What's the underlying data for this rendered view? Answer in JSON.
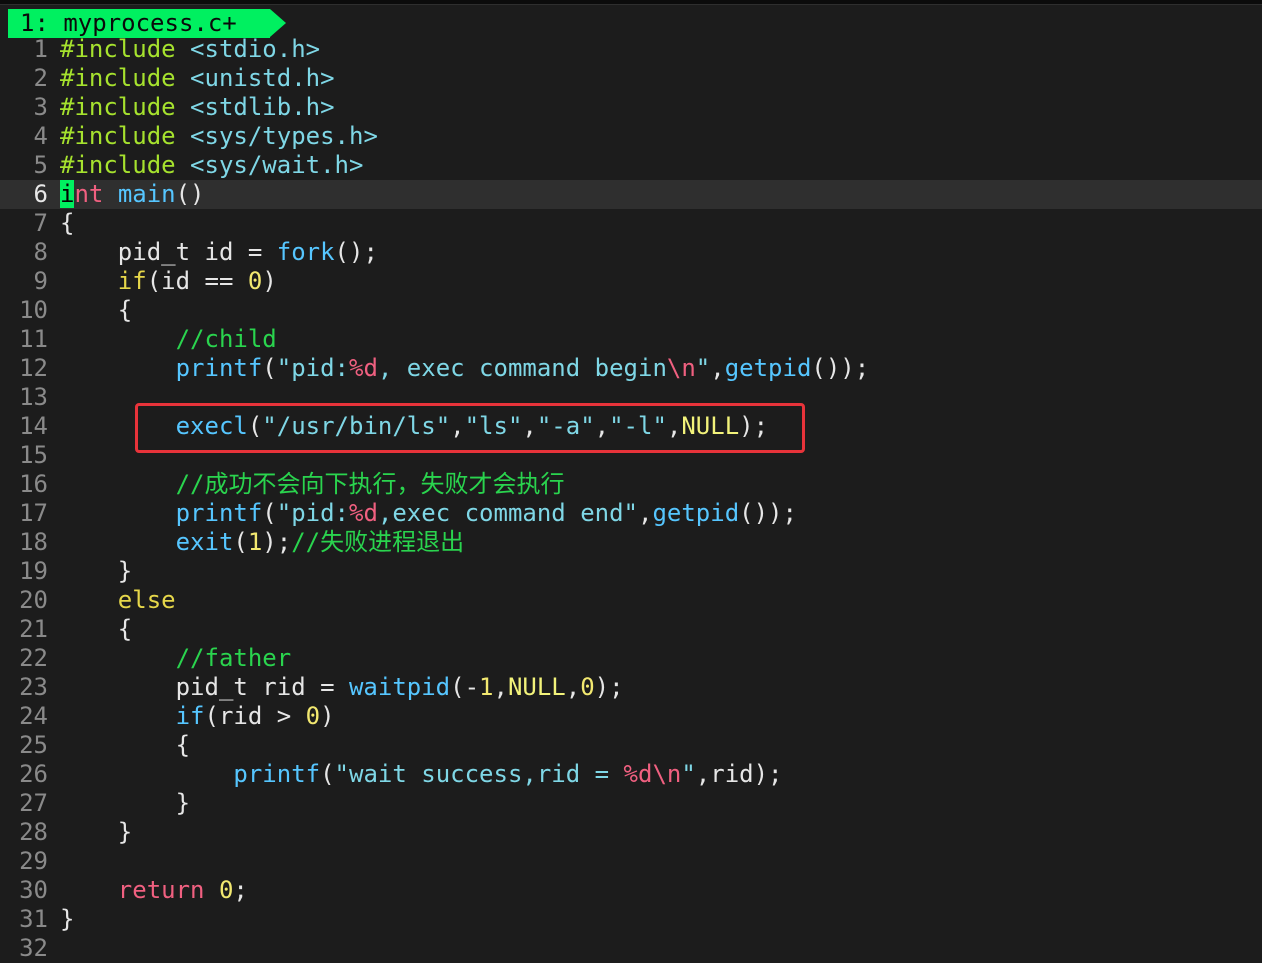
{
  "tab": {
    "label": "1: myprocess.c+"
  },
  "cursor_line": 6,
  "highlight": {
    "line": 14,
    "color": "#e8333a"
  },
  "colors": {
    "tab_bg": "#00f060",
    "background": "#1c1c1c",
    "current_line": "#2f2f2f"
  },
  "lines": [
    {
      "n": "1",
      "segs": [
        [
          "pre",
          "#include"
        ],
        [
          "plain",
          " "
        ],
        [
          "inc",
          "<stdio.h>"
        ]
      ]
    },
    {
      "n": "2",
      "segs": [
        [
          "pre",
          "#include"
        ],
        [
          "plain",
          " "
        ],
        [
          "inc",
          "<unistd.h>"
        ]
      ]
    },
    {
      "n": "3",
      "segs": [
        [
          "pre",
          "#include"
        ],
        [
          "plain",
          " "
        ],
        [
          "inc",
          "<stdlib.h>"
        ]
      ]
    },
    {
      "n": "4",
      "segs": [
        [
          "pre",
          "#include"
        ],
        [
          "plain",
          " "
        ],
        [
          "inc",
          "<sys/types.h>"
        ]
      ]
    },
    {
      "n": "5",
      "segs": [
        [
          "pre",
          "#include"
        ],
        [
          "plain",
          " "
        ],
        [
          "inc",
          "<sys/wait.h>"
        ]
      ]
    },
    {
      "n": "6",
      "segs": [
        [
          "cursor",
          "i"
        ],
        [
          "type",
          "nt"
        ],
        [
          "plain",
          " "
        ],
        [
          "fn",
          "main"
        ],
        [
          "plain",
          "()"
        ]
      ]
    },
    {
      "n": "7",
      "segs": [
        [
          "plain",
          "{"
        ]
      ]
    },
    {
      "n": "8",
      "segs": [
        [
          "plain",
          "    pid_t id = "
        ],
        [
          "fn",
          "fork"
        ],
        [
          "plain",
          "();"
        ]
      ]
    },
    {
      "n": "9",
      "segs": [
        [
          "plain",
          "    "
        ],
        [
          "kw",
          "if"
        ],
        [
          "plain",
          "(id == "
        ],
        [
          "num",
          "0"
        ],
        [
          "plain",
          ")"
        ]
      ]
    },
    {
      "n": "10",
      "segs": [
        [
          "plain",
          "    {"
        ]
      ]
    },
    {
      "n": "11",
      "segs": [
        [
          "plain",
          "        "
        ],
        [
          "cmt",
          "//child"
        ]
      ]
    },
    {
      "n": "12",
      "segs": [
        [
          "plain",
          "        "
        ],
        [
          "fn",
          "printf"
        ],
        [
          "plain",
          "("
        ],
        [
          "str",
          "\"pid:"
        ],
        [
          "fmt",
          "%d"
        ],
        [
          "str",
          ", exec command begin"
        ],
        [
          "fmt",
          "\\n"
        ],
        [
          "str",
          "\""
        ],
        [
          "plain",
          ","
        ],
        [
          "fn",
          "getpid"
        ],
        [
          "plain",
          "());"
        ]
      ]
    },
    {
      "n": "13",
      "segs": []
    },
    {
      "n": "14",
      "segs": [
        [
          "plain",
          "        "
        ],
        [
          "fn",
          "execl"
        ],
        [
          "plain",
          "("
        ],
        [
          "str",
          "\"/usr/bin/ls\""
        ],
        [
          "plain",
          ","
        ],
        [
          "str",
          "\"ls\""
        ],
        [
          "plain",
          ","
        ],
        [
          "str",
          "\"-a\""
        ],
        [
          "plain",
          ","
        ],
        [
          "str",
          "\"-l\""
        ],
        [
          "plain",
          ","
        ],
        [
          "nul",
          "NULL"
        ],
        [
          "plain",
          ");"
        ]
      ]
    },
    {
      "n": "15",
      "segs": []
    },
    {
      "n": "16",
      "segs": [
        [
          "plain",
          "        "
        ],
        [
          "cmt",
          "//成功不会向下执行，失败才会执行"
        ]
      ]
    },
    {
      "n": "17",
      "segs": [
        [
          "plain",
          "        "
        ],
        [
          "fn",
          "printf"
        ],
        [
          "plain",
          "("
        ],
        [
          "str",
          "\"pid:"
        ],
        [
          "fmt",
          "%d"
        ],
        [
          "str",
          ",exec command end\""
        ],
        [
          "plain",
          ","
        ],
        [
          "fn",
          "getpid"
        ],
        [
          "plain",
          "());"
        ]
      ]
    },
    {
      "n": "18",
      "segs": [
        [
          "plain",
          "        "
        ],
        [
          "fn",
          "exit"
        ],
        [
          "plain",
          "("
        ],
        [
          "num",
          "1"
        ],
        [
          "plain",
          ");"
        ],
        [
          "cmt",
          "//失败进程退出"
        ]
      ]
    },
    {
      "n": "19",
      "segs": [
        [
          "plain",
          "    }"
        ]
      ]
    },
    {
      "n": "20",
      "segs": [
        [
          "plain",
          "    "
        ],
        [
          "kw",
          "else"
        ]
      ]
    },
    {
      "n": "21",
      "segs": [
        [
          "plain",
          "    {"
        ]
      ]
    },
    {
      "n": "22",
      "segs": [
        [
          "plain",
          "        "
        ],
        [
          "cmt",
          "//father"
        ]
      ]
    },
    {
      "n": "23",
      "segs": [
        [
          "plain",
          "        pid_t rid = "
        ],
        [
          "fn",
          "waitpid"
        ],
        [
          "plain",
          "(-"
        ],
        [
          "num",
          "1"
        ],
        [
          "plain",
          ","
        ],
        [
          "nul",
          "NULL"
        ],
        [
          "plain",
          ","
        ],
        [
          "num",
          "0"
        ],
        [
          "plain",
          ");"
        ]
      ]
    },
    {
      "n": "24",
      "segs": [
        [
          "plain",
          "        "
        ],
        [
          "fn",
          "if"
        ],
        [
          "plain",
          "(rid > "
        ],
        [
          "num",
          "0"
        ],
        [
          "plain",
          ")"
        ]
      ]
    },
    {
      "n": "25",
      "segs": [
        [
          "plain",
          "        {"
        ]
      ]
    },
    {
      "n": "26",
      "segs": [
        [
          "plain",
          "            "
        ],
        [
          "fn",
          "printf"
        ],
        [
          "plain",
          "("
        ],
        [
          "str",
          "\"wait success,rid = "
        ],
        [
          "fmt",
          "%d"
        ],
        [
          "fmt",
          "\\n"
        ],
        [
          "str",
          "\""
        ],
        [
          "plain",
          ",rid);"
        ]
      ]
    },
    {
      "n": "27",
      "segs": [
        [
          "plain",
          "        }"
        ]
      ]
    },
    {
      "n": "28",
      "segs": [
        [
          "plain",
          "    }"
        ]
      ]
    },
    {
      "n": "29",
      "segs": []
    },
    {
      "n": "30",
      "segs": [
        [
          "plain",
          "    "
        ],
        [
          "red",
          "return"
        ],
        [
          "plain",
          " "
        ],
        [
          "num",
          "0"
        ],
        [
          "plain",
          ";"
        ]
      ]
    },
    {
      "n": "31",
      "segs": [
        [
          "plain",
          "}"
        ]
      ]
    },
    {
      "n": "32",
      "segs": []
    }
  ]
}
